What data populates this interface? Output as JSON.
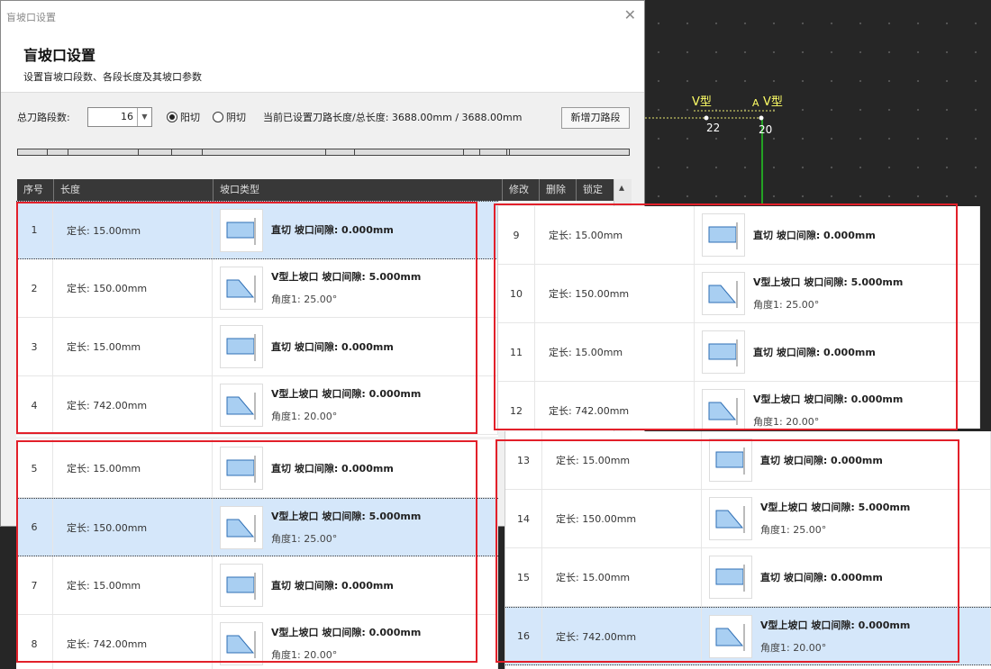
{
  "dialog": {
    "window_title": "盲坡口设置",
    "heading": "盲坡口设置",
    "description": "设置盲坡口段数、各段长度及其坡口参数",
    "segments_label": "总刀路段数:",
    "segments_value": "16",
    "radio_yang": "阳切",
    "radio_yin": "阴切",
    "length_info": "当前已设置刀路长度/总长度: 3688.00mm / 3688.00mm",
    "add_button": "新增刀路段"
  },
  "table": {
    "columns": [
      "序号",
      "长度",
      "坡口类型",
      "修改",
      "删除",
      "锁定"
    ]
  },
  "cad": {
    "label_v1": "V型",
    "label_a": "A",
    "label_v2": "V型",
    "num_22": "22",
    "num_20": "20"
  },
  "panels": [
    {
      "rows": [
        {
          "idx": "1",
          "length": "定长: 15.00mm",
          "type": "直切   坡口间隙: 0.000mm",
          "angle": "",
          "shape": "straight",
          "sel": true
        },
        {
          "idx": "2",
          "length": "定长: 150.00mm",
          "type": "V型上坡口   坡口间隙: 5.000mm",
          "angle": "角度1: 25.00°",
          "shape": "bevel",
          "sel": false
        },
        {
          "idx": "3",
          "length": "定长: 15.00mm",
          "type": "直切   坡口间隙: 0.000mm",
          "angle": "",
          "shape": "straight",
          "sel": false
        },
        {
          "idx": "4",
          "length": "定长: 742.00mm",
          "type": "V型上坡口   坡口间隙: 0.000mm",
          "angle": "角度1: 20.00°",
          "shape": "bevel",
          "sel": false
        }
      ]
    },
    {
      "rows": [
        {
          "idx": "5",
          "length": "定长: 15.00mm",
          "type": "直切   坡口间隙: 0.000mm",
          "angle": "",
          "shape": "straight",
          "sel": false
        },
        {
          "idx": "6",
          "length": "定长: 150.00mm",
          "type": "V型上坡口   坡口间隙: 5.000mm",
          "angle": "角度1: 25.00°",
          "shape": "bevel",
          "sel": true
        },
        {
          "idx": "7",
          "length": "定长: 15.00mm",
          "type": "直切   坡口间隙: 0.000mm",
          "angle": "",
          "shape": "straight",
          "sel": false
        },
        {
          "idx": "8",
          "length": "定长: 742.00mm",
          "type": "V型上坡口   坡口间隙: 0.000mm",
          "angle": "角度1: 20.00°",
          "shape": "bevel",
          "sel": false
        }
      ]
    },
    {
      "rows": [
        {
          "idx": "9",
          "length": "定长: 15.00mm",
          "type": "直切   坡口间隙: 0.000mm",
          "angle": "",
          "shape": "straight",
          "sel": false
        },
        {
          "idx": "10",
          "length": "定长: 150.00mm",
          "type": "V型上坡口   坡口间隙: 5.000mm",
          "angle": "角度1: 25.00°",
          "shape": "bevel",
          "sel": false
        },
        {
          "idx": "11",
          "length": "定长: 15.00mm",
          "type": "直切   坡口间隙: 0.000mm",
          "angle": "",
          "shape": "straight",
          "sel": false
        },
        {
          "idx": "12",
          "length": "定长: 742.00mm",
          "type": "V型上坡口   坡口间隙: 0.000mm",
          "angle": "角度1: 20.00°",
          "shape": "bevel",
          "sel": false
        }
      ]
    },
    {
      "rows": [
        {
          "idx": "13",
          "length": "定长: 15.00mm",
          "type": "直切   坡口间隙: 0.000mm",
          "angle": "",
          "shape": "straight",
          "sel": false
        },
        {
          "idx": "14",
          "length": "定长: 150.00mm",
          "type": "V型上坡口   坡口间隙: 5.000mm",
          "angle": "角度1: 25.00°",
          "shape": "bevel",
          "sel": false
        },
        {
          "idx": "15",
          "length": "定长: 15.00mm",
          "type": "直切   坡口间隙: 0.000mm",
          "angle": "",
          "shape": "straight",
          "sel": false
        },
        {
          "idx": "16",
          "length": "定长: 742.00mm",
          "type": "V型上坡口   坡口间隙: 0.000mm",
          "angle": "角度1: 20.00°",
          "shape": "bevel",
          "sel": true
        }
      ]
    }
  ]
}
